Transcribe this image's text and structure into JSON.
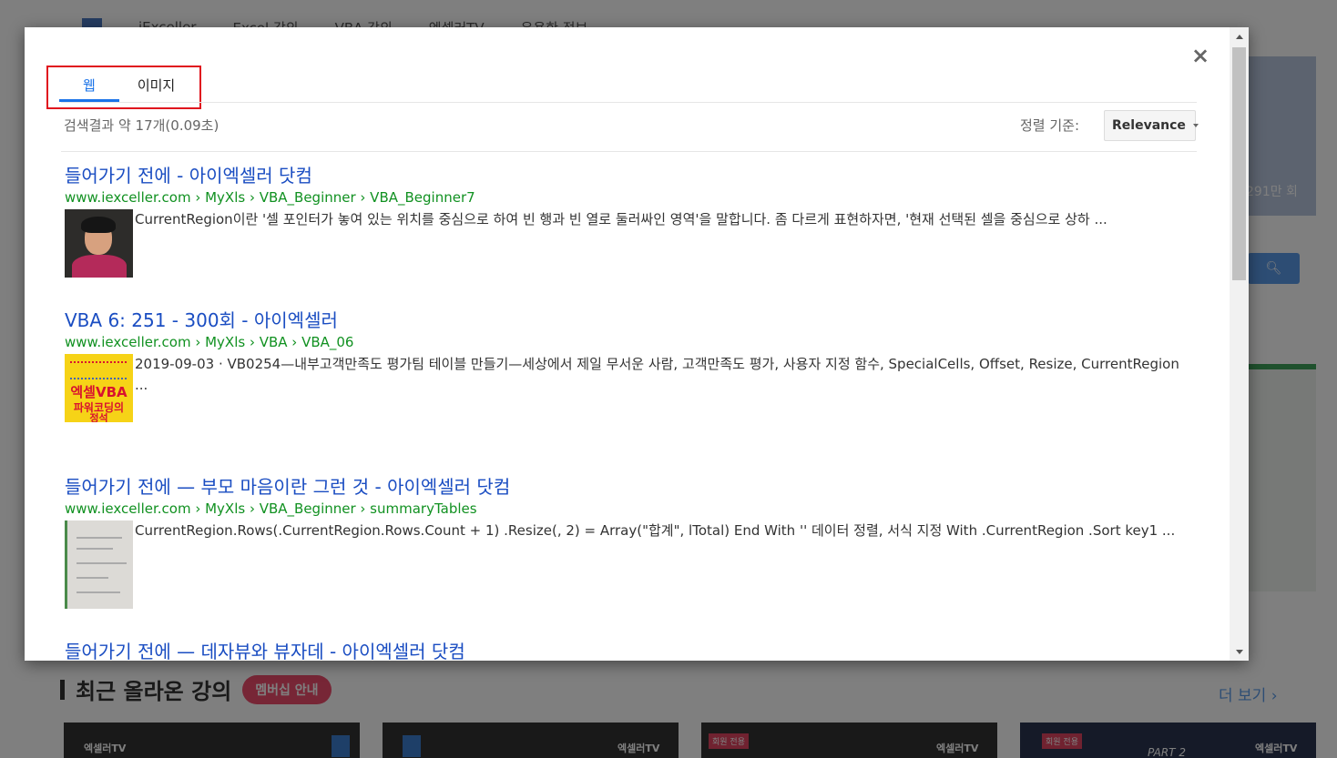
{
  "background": {
    "nav": [
      "iExceller",
      "Excel 강의",
      "VBA 강의",
      "엑셀러TV",
      "유용한 정보"
    ],
    "right_count": "291만 회",
    "section_title": "최근 올라온 강의",
    "section_badge": "멤버십 안내",
    "more_link": "더 보기 ›",
    "card_label": "엑셀러TV",
    "card_badge": "회원 전용",
    "card_part": "PART 2"
  },
  "modal": {
    "close_label": "×",
    "tabs": [
      {
        "label": "웹",
        "active": true
      },
      {
        "label": "이미지",
        "active": false
      }
    ],
    "result_info": "검색결과 약 17개(0.09초)",
    "sort_label": "정렬 기준:",
    "sort_value": "Relevance",
    "results": [
      {
        "title": "들어가기 전에 - 아이엑셀러 닷컴",
        "url": "www.iexceller.com › MyXls › VBA_Beginner › VBA_Beginner7",
        "snippet": "CurrentRegion이란 '셀 포인터가 놓여 있는 위치를 중심으로 하여 빈 행과 빈 열로 둘러싸인 영역'을 말합니다. 좀 다르게 표현하자면, '현재 선택된 셀을 중심으로 상하 ..."
      },
      {
        "title": "VBA 6: 251 - 300회 - 아이엑셀러",
        "url": "www.iexceller.com › MyXls › VBA › VBA_06",
        "snippet": "2019-09-03 · VB0254—내부고객만족도 평가팀 테이블 만들기—세상에서 제일 무서운 사람, 고객만족도 평가, 사용자 지정 함수, SpecialCells, Offset, Resize, CurrentRegion ...",
        "thumb_text": [
          "엑셀VBA",
          "파워코딩의",
          "정석"
        ]
      },
      {
        "title": "들어가기 전에 — 부모 마음이란 그런 것 - 아이엑셀러 닷컴",
        "url": "www.iexceller.com › MyXls › VBA_Beginner › summaryTables",
        "snippet": "CurrentRegion.Rows(.CurrentRegion.Rows.Count + 1) .Resize(, 2) = Array(\"합계\", lTotal) End With '' 데이터 정렬, 서식 지정 With .CurrentRegion .Sort key1 ..."
      },
      {
        "title": "들어가기 전에 — 데자뷰와 뷰자데 - 아이엑셀러 닷컴"
      }
    ]
  },
  "colors": {
    "link": "#1a4dc2",
    "url_green": "#119121",
    "active_tab": "#1a73e8",
    "highlight_red": "#e0141e"
  }
}
